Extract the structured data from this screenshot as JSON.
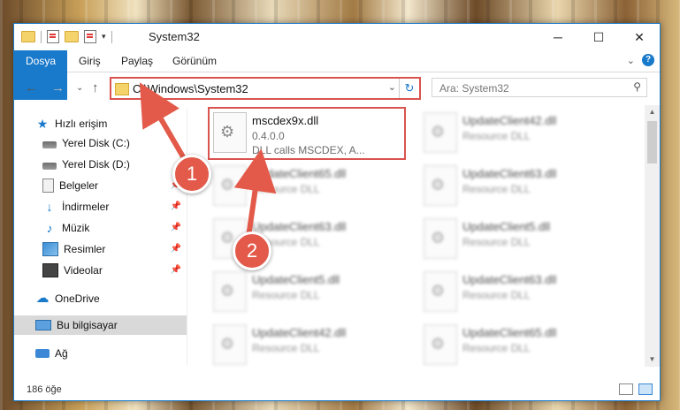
{
  "window": {
    "title": "System32",
    "controls": {
      "minimize": "─",
      "maximize": "☐",
      "close": "✕"
    }
  },
  "ribbon": {
    "tabs": [
      "Dosya",
      "Giriş",
      "Paylaş",
      "Görünüm"
    ],
    "expand": "⌄",
    "help": "?"
  },
  "nav": {
    "back": "←",
    "forward": "→",
    "recent": "⌄",
    "up": "↑",
    "address": "C:\\Windows\\System32",
    "search_placeholder": "Ara: System32"
  },
  "sidebar": {
    "items": [
      {
        "label": "Hızlı erişim",
        "icon": "star-icon"
      },
      {
        "label": "Yerel Disk (C:)",
        "icon": "disk-icon"
      },
      {
        "label": "Yerel Disk (D:)",
        "icon": "disk-icon"
      },
      {
        "label": "Belgeler",
        "icon": "document-icon"
      },
      {
        "label": "İndirmeler",
        "icon": "download-icon"
      },
      {
        "label": "Müzik",
        "icon": "music-icon"
      },
      {
        "label": "Resimler",
        "icon": "pictures-icon"
      },
      {
        "label": "Videolar",
        "icon": "video-icon"
      },
      {
        "label": "OneDrive",
        "icon": "cloud-icon"
      },
      {
        "label": "Bu bilgisayar",
        "icon": "computer-icon"
      },
      {
        "label": "Ağ",
        "icon": "network-icon"
      }
    ]
  },
  "files": [
    {
      "name": "mscdex9x.dll",
      "line2": "0.4.0.0",
      "line3": "DLL calls MSCDEX, A...",
      "blurred": false
    },
    {
      "name": "UpdateClient42.dll",
      "line2": "Resource DLL",
      "line3": "",
      "blurred": true
    },
    {
      "name": "UpdateClient65.dll",
      "line2": "Resource DLL",
      "line3": "",
      "blurred": true
    },
    {
      "name": "UpdateClient63.dll",
      "line2": "Resource DLL",
      "line3": "",
      "blurred": true
    },
    {
      "name": "UpdateClient63.dll",
      "line2": "Resource DLL",
      "line3": "",
      "blurred": true
    },
    {
      "name": "UpdateClient5.dll",
      "line2": "Resource DLL",
      "line3": "",
      "blurred": true
    },
    {
      "name": "UpdateClient5.dll",
      "line2": "Resource DLL",
      "line3": "",
      "blurred": true
    },
    {
      "name": "UpdateClient63.dll",
      "line2": "Resource DLL",
      "line3": "",
      "blurred": true
    },
    {
      "name": "UpdateClient42.dll",
      "line2": "Resource DLL",
      "line3": "",
      "blurred": true
    },
    {
      "name": "UpdateClient65.dll",
      "line2": "Resource DLL",
      "line3": "",
      "blurred": true
    }
  ],
  "status": {
    "count": "186 öğe"
  },
  "annotations": {
    "step1": "1",
    "step2": "2"
  },
  "colors": {
    "accent": "#1979ca",
    "highlight": "#d9534f"
  }
}
